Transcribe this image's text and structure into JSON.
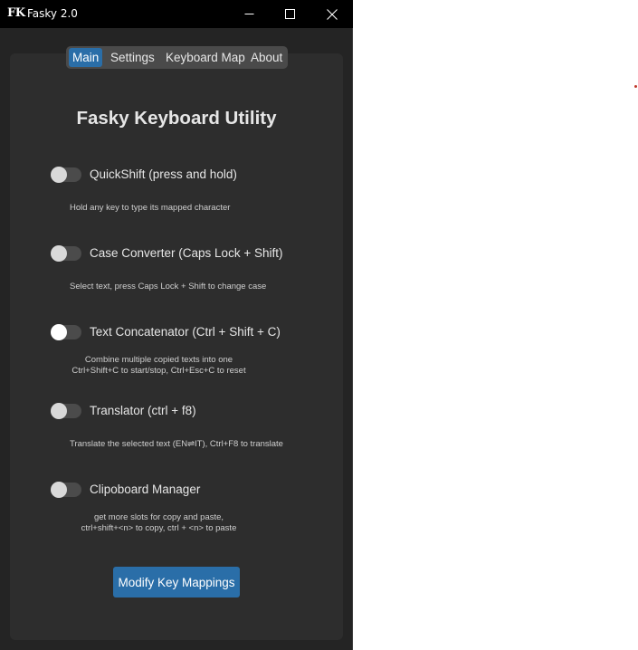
{
  "window": {
    "logo_text": "FK",
    "title": "Fasky 2.0"
  },
  "tabs": [
    {
      "label": "Main",
      "active": true
    },
    {
      "label": "Settings",
      "active": false
    },
    {
      "label": "Keyboard Map",
      "active": false
    },
    {
      "label": "About",
      "active": false
    }
  ],
  "main": {
    "heading": "Fasky Keyboard Utility",
    "features": [
      {
        "label": "QuickShift (press and hold)",
        "enabled": false,
        "desc": [
          "Hold any key to type its mapped character"
        ]
      },
      {
        "label": "Case Converter (Caps Lock + Shift)",
        "enabled": false,
        "desc": [
          "Select text, press Caps Lock + Shift to change case"
        ]
      },
      {
        "label": "Text Concatenator (Ctrl + Shift + C)",
        "enabled": false,
        "desc": [
          "Combine multiple copied texts into one",
          "Ctrl+Shift+C to start/stop, Ctrl+Esc+C to reset"
        ]
      },
      {
        "label": "Translator (ctrl + f8)",
        "enabled": false,
        "desc": [
          "Translate the selected text (EN⇌IT), Ctrl+F8 to translate"
        ]
      },
      {
        "label": "Clipoboard Manager",
        "enabled": false,
        "desc": [
          "get more slots for copy and paste,",
          "ctrl+shift+<n> to copy, ctrl + <n> to paste"
        ]
      }
    ],
    "modify_button": "Modify Key Mappings"
  },
  "colors": {
    "accent": "#2a6ea8",
    "titlebar": "#000000",
    "window_bg": "#242424",
    "panel_bg": "#2d2d2d",
    "toggle_track": "#4b4b4b",
    "toggle_knob": "#d9d9d9"
  },
  "icons": [
    "minimize-icon",
    "maximize-icon",
    "close-icon"
  ]
}
